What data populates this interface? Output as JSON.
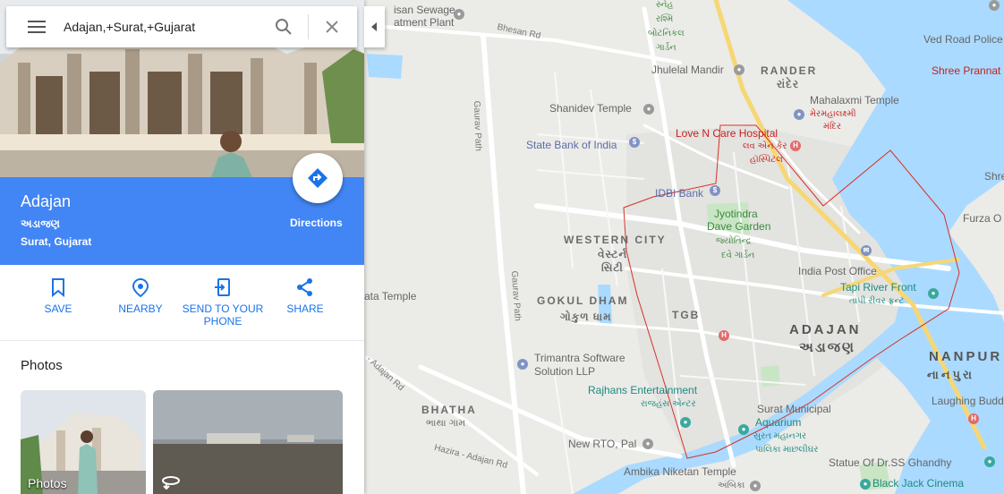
{
  "search": {
    "query": "Adajan,+Surat,+Gujarat"
  },
  "place": {
    "name": "Adajan",
    "name_gujarati": "અડાજણ",
    "address": "Surat, Gujarat",
    "directions_label": "Directions"
  },
  "actions": [
    {
      "label": "SAVE",
      "icon": "bookmark-icon"
    },
    {
      "label": "NEARBY",
      "icon": "location-pin-icon"
    },
    {
      "label": "SEND TO YOUR PHONE",
      "icon": "send-to-phone-icon"
    },
    {
      "label": "SHARE",
      "icon": "share-icon"
    }
  ],
  "photos": {
    "title": "Photos",
    "items": [
      {
        "caption": "Photos"
      },
      {
        "caption": "",
        "icon": "360-view-icon"
      }
    ]
  },
  "map": {
    "areas": {
      "rander": "RANDER",
      "rander_gu": "રાંદેર",
      "western_city": "WESTERN CITY",
      "western_city_gu1": "વેસ્ટર્ન",
      "western_city_gu2": "સિટી",
      "gokul_dham": "GOKUL DHAM",
      "gokul_dham_gu": "ગોકુળ ધામ",
      "tgb": "TGB",
      "adajan": "ADAJAN",
      "adajan_gu": "અડાજણ",
      "bhatha": "BHATHA",
      "bhatha_gu": "ભાથા ગામ",
      "nanpur": "NANPUR",
      "nanpur_gu": "નાનપુરા"
    },
    "roads": {
      "bhesan": "Bhesan Rd",
      "gaurav1": "Gaurav Path",
      "gaurav2": "Gaurav Path",
      "adajan_rd": "- Adajan Rd",
      "hazira": "Hazira - Adajan Rd"
    },
    "pois": {
      "sewage1": "isan Sewage",
      "sewage2": "atment Plant",
      "botanical_gu1": "સ્નેહ",
      "botanical_gu2": "રશ્મિ",
      "botanical_gu3": "બોટનિકલ",
      "botanical_gu4": "ગાર્ડન",
      "jhulelal": "Jhulelal Mandir",
      "mahalaxmi": "Mahalaxmi Temple",
      "mahalaxmi_gu1": "મેરમહાલક્ષ્મી",
      "mahalaxmi_gu2": "મંદિર",
      "shanidev": "Shanidev Temple",
      "sbi": "State Bank of India",
      "love_n_care": "Love N Care Hospital",
      "love_n_care_gu1": "લવ એન કેર",
      "love_n_care_gu2": "હૉસ્પિટલ",
      "idbi": "IDBI Bank",
      "jyotindra1": "Jyotindra",
      "jyotindra2": "Dave Garden",
      "jyotindra_gu1": "જ્યોતિન્દ્ર",
      "jyotindra_gu2": "દવે ગાર્ડન",
      "india_post": "India Post Office",
      "tapi1": "Tapi River Front",
      "tapi_gu": "તાપી રીવર ફ્રન્ટ",
      "ata_temple": "ata Temple",
      "trimantra1": "Trimantra Software",
      "trimantra2": "Solution LLP",
      "rajhans": "Rajhans Entertainment",
      "rajhans_gu": "રાજહંસ એન્ટર",
      "aquarium1": "Surat Municipal",
      "aquarium2": "Aquarium",
      "aquarium_gu1": "સુરત મહાનગર",
      "aquarium_gu2": "પાલિકા માછલીઘર",
      "new_rto": "New RTO, Pal",
      "ambika1": "Ambika Niketan Temple",
      "ambika_gu": "અંબિકા",
      "ved_road": "Ved Road Police",
      "shree_pranat": "Shree Prannat",
      "shre": "Shre",
      "furza": "Furza O",
      "laughing_buddha": "Laughing Buddha S",
      "ss_ghandhy": "Statue Of Dr.SS Ghandhy",
      "black_jack": "Black Jack Cinema"
    }
  },
  "colors": {
    "accent": "#4285f4",
    "action_blue": "#1a73e8",
    "water": "#aadaff",
    "boundary": "#d93025"
  }
}
